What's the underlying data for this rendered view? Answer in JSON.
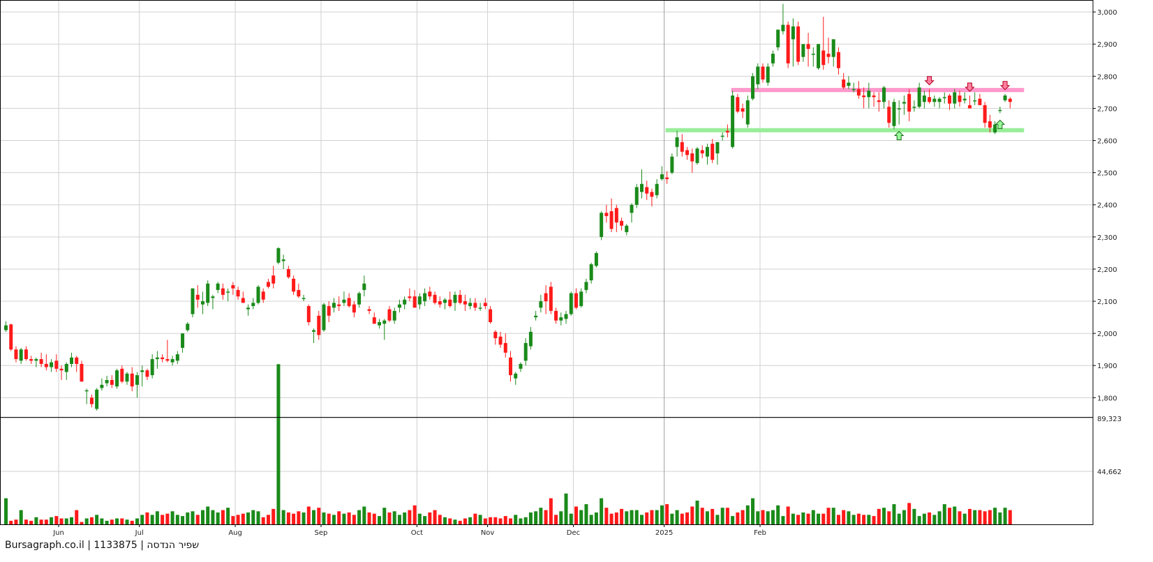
{
  "watermark": "Bursagraph.co.il | 1133875 | שפיר הנדסה",
  "chart_data": {
    "type": "candlestick",
    "price_axis": {
      "ticks": [
        1800,
        1900,
        2000,
        2100,
        2200,
        2300,
        2400,
        2500,
        2600,
        2700,
        2800,
        2900,
        3000
      ],
      "labels": [
        "1,800",
        "1,900",
        "2,000",
        "2,100",
        "2,200",
        "2,300",
        "2,400",
        "2,500",
        "2,600",
        "2,700",
        "2,800",
        "2,900",
        "3,000"
      ],
      "range": [
        1740,
        3035
      ]
    },
    "volume_axis": {
      "ticks": [
        44662,
        89323
      ],
      "labels": [
        "44,662",
        "89,323"
      ],
      "range": [
        0,
        89323
      ]
    },
    "x_labels": [
      "Jun",
      "Jul",
      "Aug",
      "Sep",
      "Oct",
      "Nov",
      "Dec",
      "2025",
      "Feb"
    ],
    "x_label_index": [
      11,
      27,
      46,
      63,
      82,
      96,
      113,
      131,
      150
    ],
    "grid": true,
    "up_color": "#1a8a1a",
    "down_color": "#ff1a1a",
    "resistance": {
      "level": 2757,
      "color": "#ff99cc"
    },
    "support": {
      "level": 2632,
      "color": "#99ee99"
    },
    "candles": [
      [
        2010,
        2038,
        2005,
        2025
      ],
      [
        2028,
        2030,
        1945,
        1950
      ],
      [
        1950,
        1960,
        1910,
        1920
      ],
      [
        1915,
        1955,
        1905,
        1950
      ],
      [
        1950,
        1960,
        1915,
        1920
      ],
      [
        1920,
        1930,
        1905,
        1915
      ],
      [
        1915,
        1925,
        1895,
        1920
      ],
      [
        1920,
        1940,
        1895,
        1905
      ],
      [
        1905,
        1935,
        1885,
        1895
      ],
      [
        1895,
        1920,
        1880,
        1910
      ],
      [
        1915,
        1935,
        1880,
        1890
      ],
      [
        1890,
        1900,
        1855,
        1885
      ],
      [
        1880,
        1910,
        1855,
        1905
      ],
      [
        1905,
        1940,
        1895,
        1925
      ],
      [
        1925,
        1930,
        1880,
        1905
      ],
      [
        1905,
        1915,
        1850,
        1850
      ],
      [
        1820,
        1828,
        1780,
        1823
      ],
      [
        1800,
        1810,
        1770,
        1780
      ],
      [
        1765,
        1830,
        1760,
        1825
      ],
      [
        1830,
        1860,
        1822,
        1840
      ],
      [
        1845,
        1868,
        1835,
        1855
      ],
      [
        1855,
        1870,
        1830,
        1840
      ],
      [
        1835,
        1890,
        1828,
        1885
      ],
      [
        1890,
        1900,
        1845,
        1850
      ],
      [
        1850,
        1880,
        1840,
        1875
      ],
      [
        1875,
        1895,
        1820,
        1835
      ],
      [
        1840,
        1880,
        1800,
        1870
      ],
      [
        1880,
        1900,
        1835,
        1885
      ],
      [
        1885,
        1890,
        1855,
        1865
      ],
      [
        1870,
        1935,
        1860,
        1920
      ],
      [
        1920,
        1945,
        1890,
        1925
      ],
      [
        1925,
        1935,
        1910,
        1920
      ],
      [
        1920,
        1980,
        1910,
        1915
      ],
      [
        1910,
        1930,
        1900,
        1920
      ],
      [
        1915,
        1945,
        1905,
        1935
      ],
      [
        1955,
        2000,
        1940,
        2000
      ],
      [
        2010,
        2035,
        2005,
        2030
      ],
      [
        2060,
        2140,
        2050,
        2140
      ],
      [
        2120,
        2150,
        2080,
        2105
      ],
      [
        2090,
        2130,
        2060,
        2100
      ],
      [
        2095,
        2165,
        2085,
        2155
      ],
      [
        2110,
        2120,
        2075,
        2115
      ],
      [
        2135,
        2160,
        2125,
        2155
      ],
      [
        2140,
        2155,
        2105,
        2120
      ],
      [
        2130,
        2140,
        2100,
        2130
      ],
      [
        2150,
        2160,
        2120,
        2140
      ],
      [
        2135,
        2145,
        2105,
        2115
      ],
      [
        2110,
        2130,
        2095,
        2095
      ],
      [
        2075,
        2090,
        2055,
        2080
      ],
      [
        2085,
        2110,
        2075,
        2095
      ],
      [
        2095,
        2150,
        2090,
        2145
      ],
      [
        2130,
        2140,
        2095,
        2105
      ],
      [
        2160,
        2170,
        2140,
        2145
      ],
      [
        2180,
        2210,
        2140,
        2155
      ],
      [
        2220,
        2268,
        2215,
        2265
      ],
      [
        2225,
        2245,
        2200,
        2230
      ],
      [
        2200,
        2210,
        2170,
        2175
      ],
      [
        2170,
        2180,
        2120,
        2130
      ],
      [
        2135,
        2155,
        2110,
        2115
      ],
      [
        2110,
        2120,
        2100,
        2110
      ],
      [
        2085,
        2090,
        2025,
        2035
      ],
      [
        2005,
        2015,
        1970,
        2010
      ],
      [
        2055,
        2070,
        1980,
        1995
      ],
      [
        2010,
        2095,
        2005,
        2090
      ],
      [
        2085,
        2100,
        2035,
        2055
      ],
      [
        2080,
        2110,
        2065,
        2095
      ],
      [
        2090,
        2115,
        2070,
        2085
      ],
      [
        2095,
        2130,
        2085,
        2105
      ],
      [
        2110,
        2125,
        2080,
        2085
      ],
      [
        2090,
        2100,
        2050,
        2065
      ],
      [
        2090,
        2130,
        2080,
        2125
      ],
      [
        2135,
        2180,
        2115,
        2155
      ],
      [
        2075,
        2085,
        2060,
        2070
      ],
      [
        2050,
        2065,
        2030,
        2030
      ],
      [
        2025,
        2045,
        2015,
        2035
      ],
      [
        2030,
        2045,
        1980,
        2040
      ],
      [
        2075,
        2085,
        2035,
        2040
      ],
      [
        2040,
        2080,
        2030,
        2070
      ],
      [
        2080,
        2105,
        2065,
        2090
      ],
      [
        2090,
        2115,
        2075,
        2105
      ],
      [
        2115,
        2140,
        2100,
        2110
      ],
      [
        2115,
        2135,
        2080,
        2080
      ],
      [
        2090,
        2125,
        2075,
        2115
      ],
      [
        2100,
        2140,
        2085,
        2125
      ],
      [
        2130,
        2145,
        2105,
        2115
      ],
      [
        2120,
        2130,
        2090,
        2095
      ],
      [
        2100,
        2115,
        2080,
        2090
      ],
      [
        2095,
        2110,
        2075,
        2105
      ],
      [
        2105,
        2130,
        2080,
        2085
      ],
      [
        2095,
        2130,
        2070,
        2120
      ],
      [
        2120,
        2135,
        2090,
        2095
      ],
      [
        2100,
        2120,
        2070,
        2090
      ],
      [
        2085,
        2110,
        2075,
        2095
      ],
      [
        2095,
        2110,
        2070,
        2080
      ],
      [
        2080,
        2095,
        2070,
        2080
      ],
      [
        2095,
        2110,
        2075,
        2085
      ],
      [
        2075,
        2085,
        2030,
        2035
      ],
      [
        2005,
        2010,
        1965,
        1985
      ],
      [
        1990,
        2005,
        1955,
        1965
      ],
      [
        1970,
        2000,
        1925,
        1940
      ],
      [
        1925,
        1945,
        1850,
        1870
      ],
      [
        1860,
        1880,
        1840,
        1875
      ],
      [
        1890,
        1910,
        1880,
        1905
      ],
      [
        1915,
        1985,
        1900,
        1970
      ],
      [
        1960,
        2020,
        1950,
        2005
      ],
      [
        2050,
        2070,
        2040,
        2055
      ],
      [
        2080,
        2120,
        2065,
        2100
      ],
      [
        2125,
        2150,
        2060,
        2100
      ],
      [
        2145,
        2160,
        2060,
        2070
      ],
      [
        2070,
        2080,
        2030,
        2040
      ],
      [
        2040,
        2065,
        2025,
        2050
      ],
      [
        2045,
        2070,
        2030,
        2060
      ],
      [
        2060,
        2130,
        2055,
        2125
      ],
      [
        2125,
        2140,
        2075,
        2080
      ],
      [
        2085,
        2140,
        2080,
        2130
      ],
      [
        2135,
        2170,
        2125,
        2160
      ],
      [
        2165,
        2220,
        2155,
        2215
      ],
      [
        2210,
        2255,
        2205,
        2250
      ],
      [
        2300,
        2380,
        2290,
        2375
      ],
      [
        2375,
        2400,
        2345,
        2365
      ],
      [
        2380,
        2420,
        2315,
        2325
      ],
      [
        2390,
        2400,
        2315,
        2345
      ],
      [
        2350,
        2360,
        2320,
        2335
      ],
      [
        2315,
        2340,
        2305,
        2335
      ],
      [
        2375,
        2405,
        2345,
        2400
      ],
      [
        2400,
        2465,
        2390,
        2455
      ],
      [
        2440,
        2510,
        2420,
        2465
      ],
      [
        2455,
        2475,
        2415,
        2435
      ],
      [
        2440,
        2450,
        2395,
        2425
      ],
      [
        2430,
        2480,
        2420,
        2465
      ],
      [
        2480,
        2520,
        2475,
        2495
      ],
      [
        2485,
        2505,
        2465,
        2480
      ],
      [
        2500,
        2560,
        2495,
        2550
      ],
      [
        2580,
        2630,
        2550,
        2610
      ],
      [
        2595,
        2620,
        2550,
        2565
      ],
      [
        2570,
        2580,
        2540,
        2555
      ],
      [
        2560,
        2575,
        2500,
        2535
      ],
      [
        2530,
        2580,
        2525,
        2575
      ],
      [
        2570,
        2585,
        2545,
        2560
      ],
      [
        2550,
        2590,
        2525,
        2580
      ],
      [
        2590,
        2605,
        2530,
        2540
      ],
      [
        2560,
        2595,
        2525,
        2595
      ],
      [
        2615,
        2625,
        2600,
        2615
      ],
      [
        2630,
        2650,
        2610,
        2625
      ],
      [
        2580,
        2755,
        2575,
        2740
      ],
      [
        2735,
        2745,
        2685,
        2690
      ],
      [
        2700,
        2715,
        2670,
        2690
      ],
      [
        2650,
        2740,
        2640,
        2725
      ],
      [
        2730,
        2810,
        2725,
        2800
      ],
      [
        2775,
        2840,
        2760,
        2830
      ],
      [
        2830,
        2840,
        2780,
        2790
      ],
      [
        2780,
        2840,
        2770,
        2830
      ],
      [
        2840,
        2880,
        2830,
        2870
      ],
      [
        2890,
        2940,
        2880,
        2945
      ],
      [
        2940,
        3025,
        2930,
        2960
      ],
      [
        2960,
        2970,
        2825,
        2840
      ],
      [
        2915,
        2980,
        2830,
        2955
      ],
      [
        2955,
        2970,
        2835,
        2845
      ],
      [
        2860,
        2900,
        2845,
        2900
      ],
      [
        2900,
        2935,
        2830,
        2885
      ],
      [
        2870,
        2890,
        2830,
        2870
      ],
      [
        2825,
        2900,
        2820,
        2900
      ],
      [
        2880,
        2985,
        2820,
        2835
      ],
      [
        2870,
        2920,
        2840,
        2860
      ],
      [
        2860,
        2915,
        2830,
        2915
      ],
      [
        2875,
        2890,
        2805,
        2825
      ],
      [
        2790,
        2810,
        2760,
        2765
      ],
      [
        2770,
        2800,
        2760,
        2780
      ],
      [
        2760,
        2780,
        2750,
        2760
      ],
      [
        2760,
        2785,
        2730,
        2740
      ],
      [
        2740,
        2765,
        2700,
        2735
      ],
      [
        2735,
        2780,
        2700,
        2755
      ],
      [
        2740,
        2750,
        2705,
        2735
      ],
      [
        2725,
        2750,
        2690,
        2720
      ],
      [
        2720,
        2770,
        2700,
        2765
      ],
      [
        2705,
        2725,
        2640,
        2655
      ],
      [
        2645,
        2730,
        2635,
        2720
      ],
      [
        2700,
        2725,
        2650,
        2700
      ],
      [
        2715,
        2740,
        2680,
        2720
      ],
      [
        2745,
        2760,
        2660,
        2690
      ],
      [
        2705,
        2725,
        2690,
        2705
      ],
      [
        2705,
        2780,
        2700,
        2765
      ],
      [
        2720,
        2755,
        2700,
        2740
      ],
      [
        2735,
        2760,
        2715,
        2720
      ],
      [
        2720,
        2740,
        2705,
        2730
      ],
      [
        2720,
        2735,
        2700,
        2730
      ],
      [
        2735,
        2750,
        2715,
        2735
      ],
      [
        2740,
        2745,
        2695,
        2715
      ],
      [
        2715,
        2760,
        2700,
        2750
      ],
      [
        2740,
        2755,
        2705,
        2720
      ],
      [
        2725,
        2750,
        2715,
        2730
      ],
      [
        2710,
        2740,
        2700,
        2700
      ],
      [
        2725,
        2750,
        2710,
        2725
      ],
      [
        2730,
        2745,
        2720,
        2710
      ],
      [
        2710,
        2720,
        2640,
        2655
      ],
      [
        2660,
        2680,
        2625,
        2640
      ],
      [
        2625,
        2660,
        2620,
        2650
      ],
      [
        2695,
        2705,
        2685,
        2695
      ],
      [
        2725,
        2745,
        2720,
        2740
      ],
      [
        2730,
        2735,
        2700,
        2720
      ]
    ],
    "volume": [
      22,
      3,
      4,
      12,
      4,
      3,
      6,
      4,
      4,
      6,
      7,
      5,
      5,
      6,
      12,
      2,
      5,
      6,
      8,
      5,
      3,
      4,
      5,
      5,
      4,
      3,
      5,
      8,
      10,
      8,
      11,
      8,
      9,
      11,
      8,
      7,
      10,
      11,
      8,
      12,
      15,
      12,
      10,
      12,
      14,
      7,
      8,
      9,
      10,
      12,
      11,
      6,
      8,
      13,
      135,
      12,
      10,
      9,
      11,
      10,
      15,
      12,
      14,
      10,
      9,
      8,
      11,
      9,
      10,
      8,
      12,
      15,
      10,
      9,
      7,
      14,
      10,
      11,
      8,
      10,
      12,
      16,
      9,
      7,
      10,
      12,
      8,
      6,
      5,
      4,
      3,
      5,
      6,
      9,
      8,
      5,
      6,
      6,
      5,
      7,
      5,
      8,
      5,
      6,
      10,
      11,
      14,
      12,
      22,
      8,
      11,
      26,
      9,
      15,
      12,
      17,
      8,
      10,
      22,
      14,
      9,
      10,
      13,
      11,
      12,
      12,
      8,
      10,
      12,
      12,
      16,
      17,
      9,
      12,
      9,
      10,
      15,
      20,
      14,
      11,
      13,
      8,
      14,
      14,
      7,
      10,
      12,
      16,
      22,
      11,
      12,
      11,
      12,
      16,
      7,
      15,
      9,
      8,
      10,
      9,
      12,
      9,
      9,
      14,
      14,
      8,
      12,
      11,
      8,
      9,
      8,
      8,
      7,
      13,
      14,
      11,
      17,
      9,
      12,
      18,
      13,
      7,
      9,
      10,
      8,
      11,
      17,
      14,
      15,
      11,
      9,
      13,
      12,
      12,
      11,
      12,
      14,
      10,
      14,
      12
    ],
    "volume_units": 1000,
    "resistance_arrows_index": [
      183,
      191,
      198
    ],
    "support_arrows_index": [
      177,
      197
    ]
  }
}
